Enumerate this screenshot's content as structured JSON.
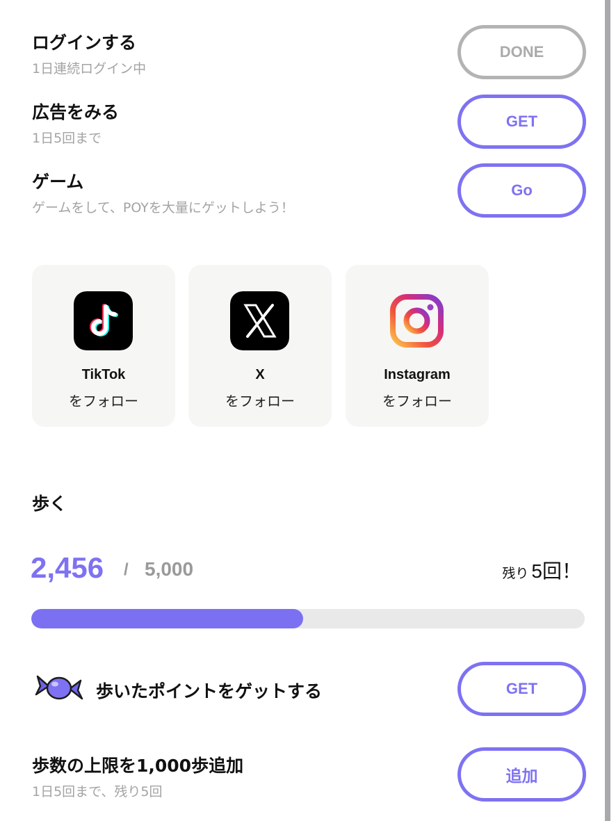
{
  "tasks": [
    {
      "title": "ログインする",
      "subtitle": "1日連続ログイン中",
      "button": "DONE"
    },
    {
      "title": "広告をみる",
      "subtitle": "1日5回まで",
      "button": "GET"
    },
    {
      "title": "ゲーム",
      "subtitle": "ゲームをして、POYを大量にゲットしよう！",
      "button": "Go"
    }
  ],
  "social": [
    {
      "name": "TikTok",
      "action": "をフォロー",
      "icon": "tiktok-icon"
    },
    {
      "name": "X",
      "action": "をフォロー",
      "icon": "x-icon"
    },
    {
      "name": "Instagram",
      "action": "をフォロー",
      "icon": "instagram-icon"
    }
  ],
  "walk": {
    "title": "歩く",
    "current": "2,456",
    "separator": "/",
    "goal": "5,000",
    "progress": 0.4912,
    "remaining_prefix": "残り",
    "remaining_count": "5",
    "remaining_suffix": "回！",
    "get_label": "歩いたポイントをゲットする",
    "get_button": "GET",
    "candy_icon": "candy-icon"
  },
  "limit": {
    "title": "歩数の上限を1,000歩追加",
    "subtitle": "1日5回まで、残り5回",
    "button": "追加"
  },
  "colors": {
    "accent": "#7e72f2",
    "done": "#b3b3b3",
    "card_bg": "#f6f6f4",
    "track": "#e9e9e9"
  }
}
